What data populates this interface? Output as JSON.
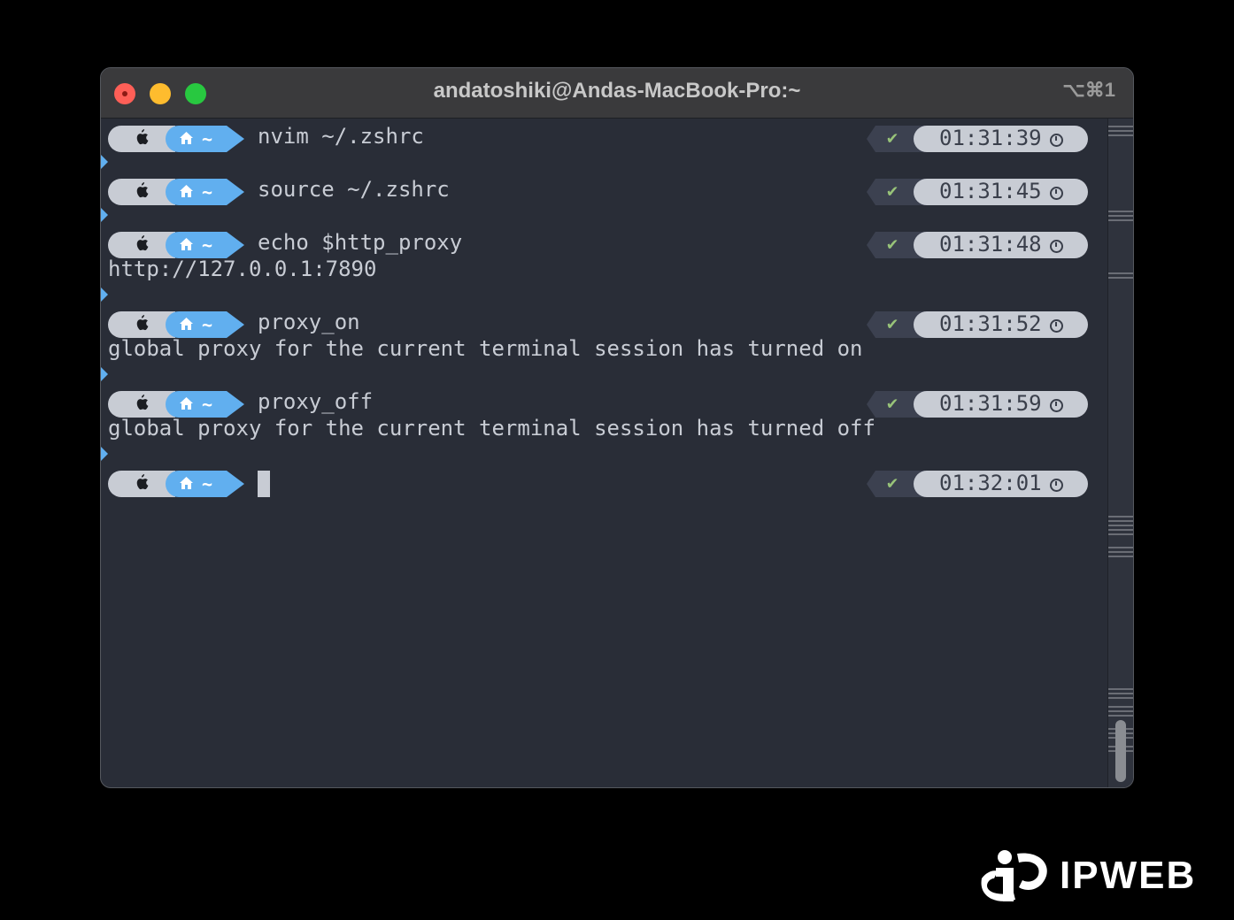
{
  "window": {
    "title": "andatoshiki@Andas-MacBook-Pro:~",
    "shortcut": "⌥⌘1"
  },
  "prompt": {
    "os_icon": "apple-icon",
    "dir_icon": "home-icon",
    "dir": "~",
    "status_icon": "checkmark-icon",
    "status_glyph": "✔",
    "time_icon": "clock-icon"
  },
  "entries": [
    {
      "command": "nvim ~/.zshrc",
      "time": "01:31:39",
      "output": []
    },
    {
      "command": "source ~/.zshrc",
      "time": "01:31:45",
      "output": []
    },
    {
      "command": "echo $http_proxy",
      "time": "01:31:48",
      "output": [
        "http://127.0.0.1:7890"
      ]
    },
    {
      "command": "proxy_on",
      "time": "01:31:52",
      "output": [
        "global proxy for the current terminal session has turned on"
      ]
    },
    {
      "command": "proxy_off",
      "time": "01:31:59",
      "output": [
        "global proxy for the current terminal session has turned off"
      ]
    },
    {
      "command": "",
      "time": "01:32:01",
      "output": []
    }
  ],
  "watermark": {
    "text": "IPWEB"
  },
  "colors": {
    "background": "#292d37",
    "dir_segment": "#61afef",
    "os_segment": "#c8ccd4",
    "status_ok": "#98c379",
    "titlebar": "#3a3a3c"
  }
}
